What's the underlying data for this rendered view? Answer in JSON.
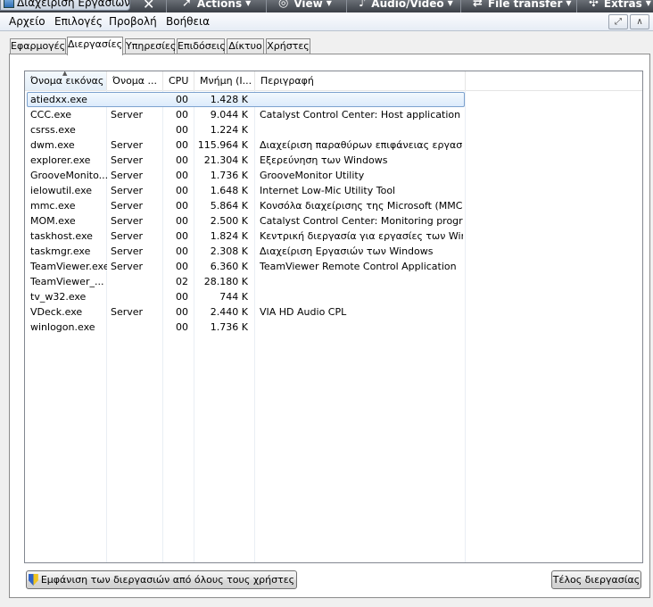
{
  "window": {
    "title": "Διαχείριση Εργασιών"
  },
  "teamviewer_toolbar": {
    "items": [
      {
        "label": "Actions",
        "icon": "arrow-icon"
      },
      {
        "label": "View",
        "icon": "view-icon"
      },
      {
        "label": "Audio/Video",
        "icon": "audio-video-icon"
      },
      {
        "label": "File transfer",
        "icon": "file-transfer-icon"
      },
      {
        "label": "Extras",
        "icon": "extras-icon"
      }
    ]
  },
  "menu": {
    "items": [
      "Αρχείο",
      "Επιλογές",
      "Προβολή",
      "Βοήθεια"
    ]
  },
  "tabs": [
    {
      "label": "Εφαρμογές",
      "active": false
    },
    {
      "label": "Διεργασίες",
      "active": true
    },
    {
      "label": "Υπηρεσίες",
      "active": false
    },
    {
      "label": "Επιδόσεις",
      "active": false
    },
    {
      "label": "Δίκτυο",
      "active": false
    },
    {
      "label": "Χρήστες",
      "active": false
    }
  ],
  "columns": [
    {
      "label": "Όνομα εικόνας",
      "sorted": true
    },
    {
      "label": "Όνομα ...",
      "sorted": false
    },
    {
      "label": "CPU",
      "sorted": false
    },
    {
      "label": "Μνήμη (Ι...",
      "sorted": false
    },
    {
      "label": "Περιγραφή",
      "sorted": false
    }
  ],
  "processes": [
    {
      "name": "atiedxx.exe",
      "user": "",
      "cpu": "00",
      "memory": "1.428 K",
      "description": "",
      "selected": true
    },
    {
      "name": "CCC.exe",
      "user": "Server",
      "cpu": "00",
      "memory": "9.044 K",
      "description": "Catalyst Control Center: Host application"
    },
    {
      "name": "csrss.exe",
      "user": "",
      "cpu": "00",
      "memory": "1.224 K",
      "description": ""
    },
    {
      "name": "dwm.exe",
      "user": "Server",
      "cpu": "00",
      "memory": "115.964 K",
      "description": "Διαχείριση παραθύρων επιφάνειας εργασίας"
    },
    {
      "name": "explorer.exe",
      "user": "Server",
      "cpu": "00",
      "memory": "21.304 K",
      "description": "Εξερεύνηση των Windows"
    },
    {
      "name": "GrooveMonito...",
      "user": "Server",
      "cpu": "00",
      "memory": "1.736 K",
      "description": "GrooveMonitor Utility"
    },
    {
      "name": "ielowutil.exe",
      "user": "Server",
      "cpu": "00",
      "memory": "1.648 K",
      "description": "Internet Low-Mic Utility Tool"
    },
    {
      "name": "mmc.exe",
      "user": "Server",
      "cpu": "00",
      "memory": "5.864 K",
      "description": "Κονσόλα διαχείρισης της Microsoft (MMC)"
    },
    {
      "name": "MOM.exe",
      "user": "Server",
      "cpu": "00",
      "memory": "2.500 K",
      "description": "Catalyst Control Center: Monitoring program"
    },
    {
      "name": "taskhost.exe",
      "user": "Server",
      "cpu": "00",
      "memory": "1.824 K",
      "description": "Κεντρική διεργασία για εργασίες των Windows"
    },
    {
      "name": "taskmgr.exe",
      "user": "Server",
      "cpu": "00",
      "memory": "2.308 K",
      "description": "Διαχείριση Εργασιών των Windows"
    },
    {
      "name": "TeamViewer.exe",
      "user": "Server",
      "cpu": "00",
      "memory": "6.360 K",
      "description": "TeamViewer Remote Control Application"
    },
    {
      "name": "TeamViewer_...",
      "user": "",
      "cpu": "02",
      "memory": "28.180 K",
      "description": ""
    },
    {
      "name": "tv_w32.exe",
      "user": "",
      "cpu": "00",
      "memory": "744 K",
      "description": ""
    },
    {
      "name": "VDeck.exe",
      "user": "Server",
      "cpu": "00",
      "memory": "2.440 K",
      "description": "VIA HD Audio CPL"
    },
    {
      "name": "winlogon.exe",
      "user": "",
      "cpu": "00",
      "memory": "1.736 K",
      "description": ""
    }
  ],
  "buttons": {
    "show_all": "Εμφάνιση των διεργασιών από όλους τους χρήστες",
    "end_process": "Τέλος διεργασίας"
  },
  "colors": {
    "selection_border": "#7da2ce",
    "menubar_bg": "#eef2f8",
    "toolbar_bg": "#4b5058"
  }
}
